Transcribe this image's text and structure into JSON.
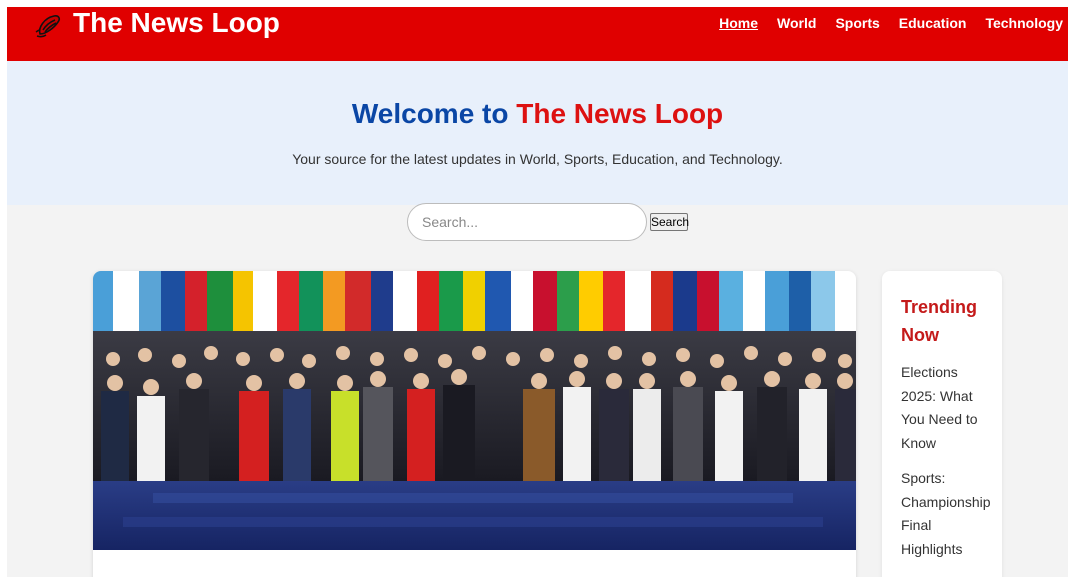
{
  "header": {
    "brand": "The News Loop",
    "logo_icon": "flying-newspaper-icon",
    "nav": [
      {
        "label": "Home",
        "active": true
      },
      {
        "label": "World",
        "active": false
      },
      {
        "label": "Sports",
        "active": false
      },
      {
        "label": "Education",
        "active": false
      },
      {
        "label": "Technology",
        "active": false
      }
    ]
  },
  "hero": {
    "welcome": "Welcome to",
    "brand": "The News Loop",
    "tagline": "Your source for the latest updates in World, Sports, Education, and Technology."
  },
  "search": {
    "placeholder": "Search...",
    "button_label": "Search"
  },
  "sidebar": {
    "title": "Trending Now",
    "items": [
      "Elections 2025: What You Need to Know",
      "Sports: Championship Final Highlights"
    ]
  },
  "colors": {
    "header_bg": "#e00000",
    "hero_bg": "#e8f0fb",
    "welcome_blue": "#0a46a5",
    "brand_red": "#dd1111",
    "trending_red": "#c41a1a"
  }
}
